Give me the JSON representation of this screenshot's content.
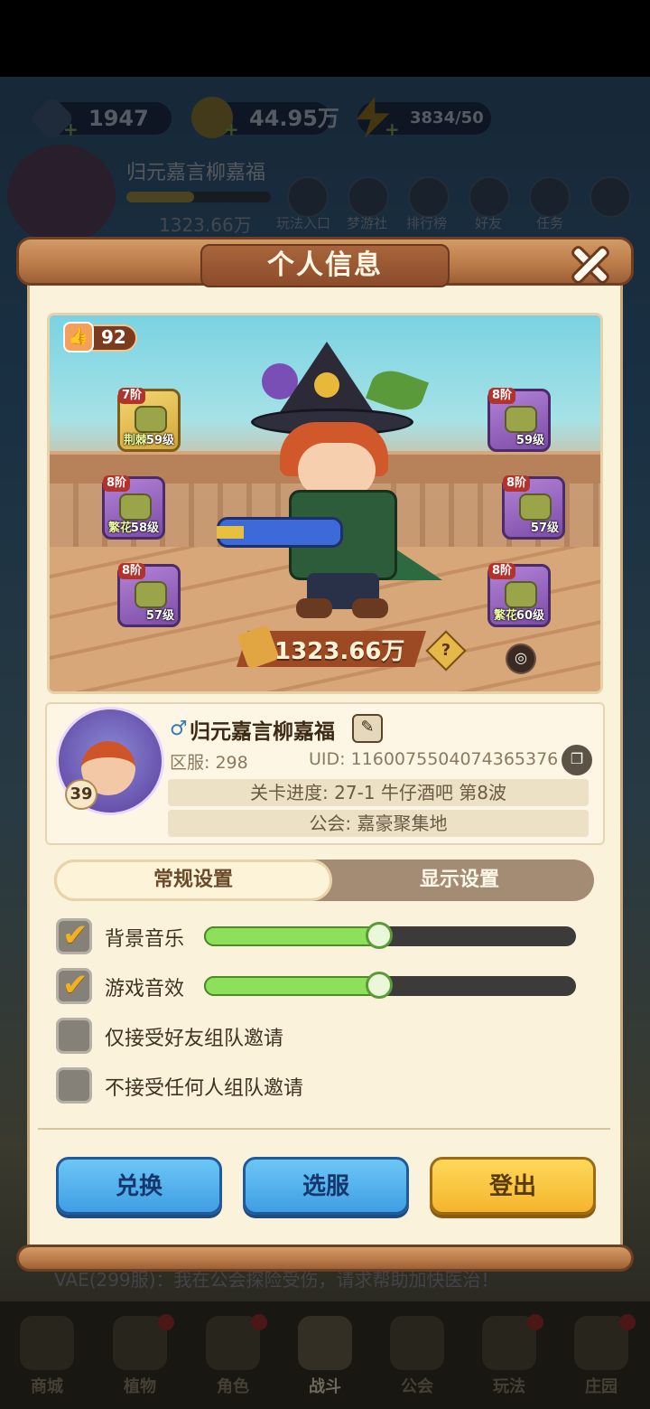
{
  "top_resources": {
    "gems": "1947",
    "gold": "44.95万",
    "energy": "3834/50"
  },
  "background_hud": {
    "player_name": "归元嘉言柳嘉福",
    "power": "1323.66万",
    "shortcuts": [
      "玩法入口",
      "梦游社",
      "排行榜",
      "好友",
      "任务"
    ],
    "chat_message": "VAE(299服)：我在公会探险受伤，请求帮助加快医治！"
  },
  "bottom_nav": [
    "商城",
    "植物",
    "角色",
    "战斗",
    "公会",
    "玩法",
    "庄园"
  ],
  "modal": {
    "title": "个人信息",
    "likes": "92",
    "equipment": [
      {
        "tier": "7阶",
        "set": "荆棘",
        "level": "59级",
        "icon": "hat-icon"
      },
      {
        "tier": "8阶",
        "set": "繁花",
        "level": "58级",
        "icon": "gloves-icon"
      },
      {
        "tier": "8阶",
        "set": "",
        "level": "57级",
        "icon": "pants-icon"
      },
      {
        "tier": "8阶",
        "set": "",
        "level": "59级",
        "icon": "armor-icon"
      },
      {
        "tier": "8阶",
        "set": "",
        "level": "57级",
        "icon": "belt-icon"
      },
      {
        "tier": "8阶",
        "set": "繁花",
        "level": "60级",
        "icon": "boots-icon"
      }
    ],
    "power": "1323.66万",
    "player": {
      "name": "归元嘉言柳嘉福",
      "level": "39",
      "server": "区服: 298",
      "uid": "UID: 1160075504074365376",
      "stage": "关卡进度: 27-1  牛仔酒吧 第8波",
      "guild": "公会:  嘉豪聚集地"
    },
    "tabs": {
      "general": "常规设置",
      "display": "显示设置",
      "active": "general"
    },
    "settings": [
      {
        "label": "背景音乐",
        "checked": true,
        "volume": 0.47
      },
      {
        "label": "游戏音效",
        "checked": true,
        "volume": 0.47
      },
      {
        "label": "仅接受好友组队邀请",
        "checked": false
      },
      {
        "label": "不接受任何人组队邀请",
        "checked": false
      }
    ],
    "buttons": {
      "redeem": "兑换",
      "server": "选服",
      "logout": "登出"
    }
  },
  "colors": {
    "accent_green": "#8ce05a",
    "button_blue": "#3f9ee4",
    "button_yellow": "#f4b52c",
    "panel": "#fbf2dc"
  }
}
